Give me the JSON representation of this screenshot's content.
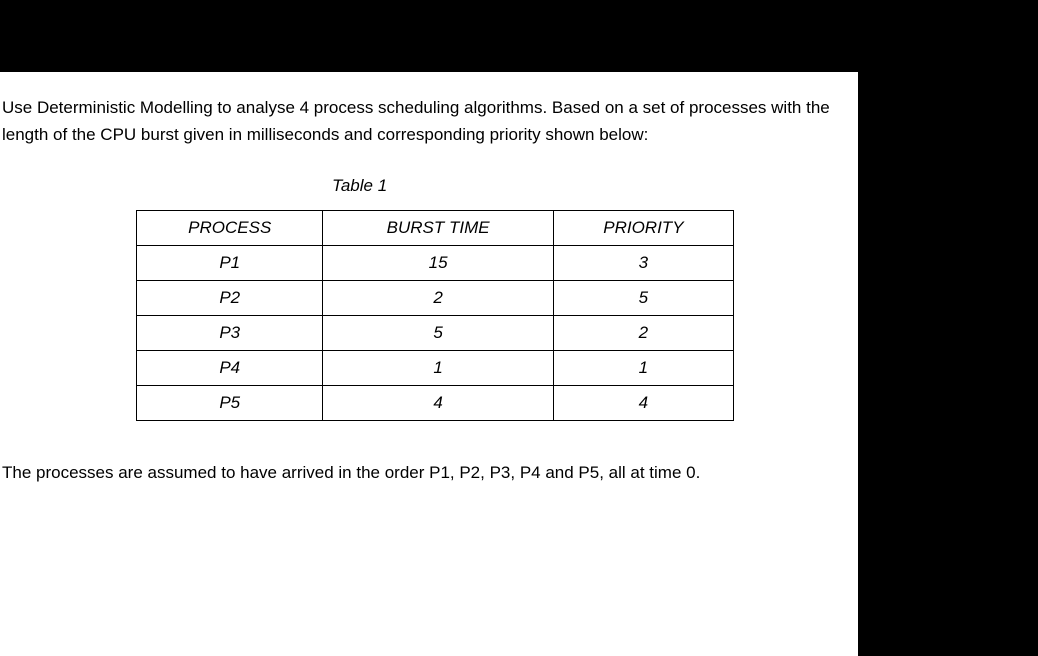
{
  "intro": "Use Deterministic Modelling to analyse 4 process scheduling algorithms. Based on a set of processes with the length of the CPU burst given in milliseconds and corresponding priority shown below:",
  "table_caption": "Table 1",
  "table": {
    "headers": [
      "PROCESS",
      "BURST TIME",
      "PRIORITY"
    ],
    "rows": [
      {
        "process": "P1",
        "burst": "15",
        "priority": "3"
      },
      {
        "process": "P2",
        "burst": "2",
        "priority": "5"
      },
      {
        "process": "P3",
        "burst": "5",
        "priority": "2"
      },
      {
        "process": "P4",
        "burst": "1",
        "priority": "1"
      },
      {
        "process": "P5",
        "burst": "4",
        "priority": "4"
      }
    ]
  },
  "outro": "The processes are assumed to have arrived in the order P1, P2, P3, P4 and P5, all at time 0."
}
